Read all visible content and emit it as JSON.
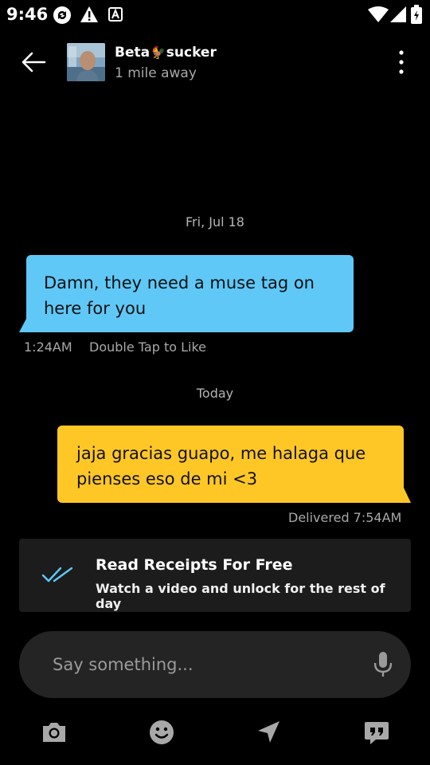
{
  "status_bar": {
    "time": "9:46",
    "icons": [
      "sync-icon",
      "warning-icon",
      "a-icon",
      "wifi-icon",
      "signal-icon",
      "battery-icon"
    ]
  },
  "header": {
    "contact_name_first": "Beta",
    "contact_name_emoji": "🐓",
    "contact_name_last": "sucker",
    "distance": "1 mile away"
  },
  "messages": [
    {
      "date": "Fri, Jul 18",
      "text": "Damn, they need a muse tag on here for you",
      "direction": "incoming",
      "time": "1:24AM",
      "hint": "Double Tap to Like"
    },
    {
      "date": "Today",
      "text": "jaja gracias guapo, me halaga que pienses eso de mi <3",
      "direction": "outgoing",
      "status": "Delivered 7:54AM"
    }
  ],
  "read_receipts": {
    "title": "Read Receipts For Free",
    "subtitle": "Watch a video and unlock for the rest of day"
  },
  "composer": {
    "placeholder": "Say something..."
  },
  "toolbar": {
    "icons": [
      "camera-icon",
      "emoji-icon",
      "location-icon",
      "saved-phrases-icon"
    ]
  },
  "colors": {
    "incoming_bubble": "#5fc8f7",
    "outgoing_bubble": "#ffc726",
    "check_accent": "#5fc8f7",
    "background": "#000000"
  }
}
